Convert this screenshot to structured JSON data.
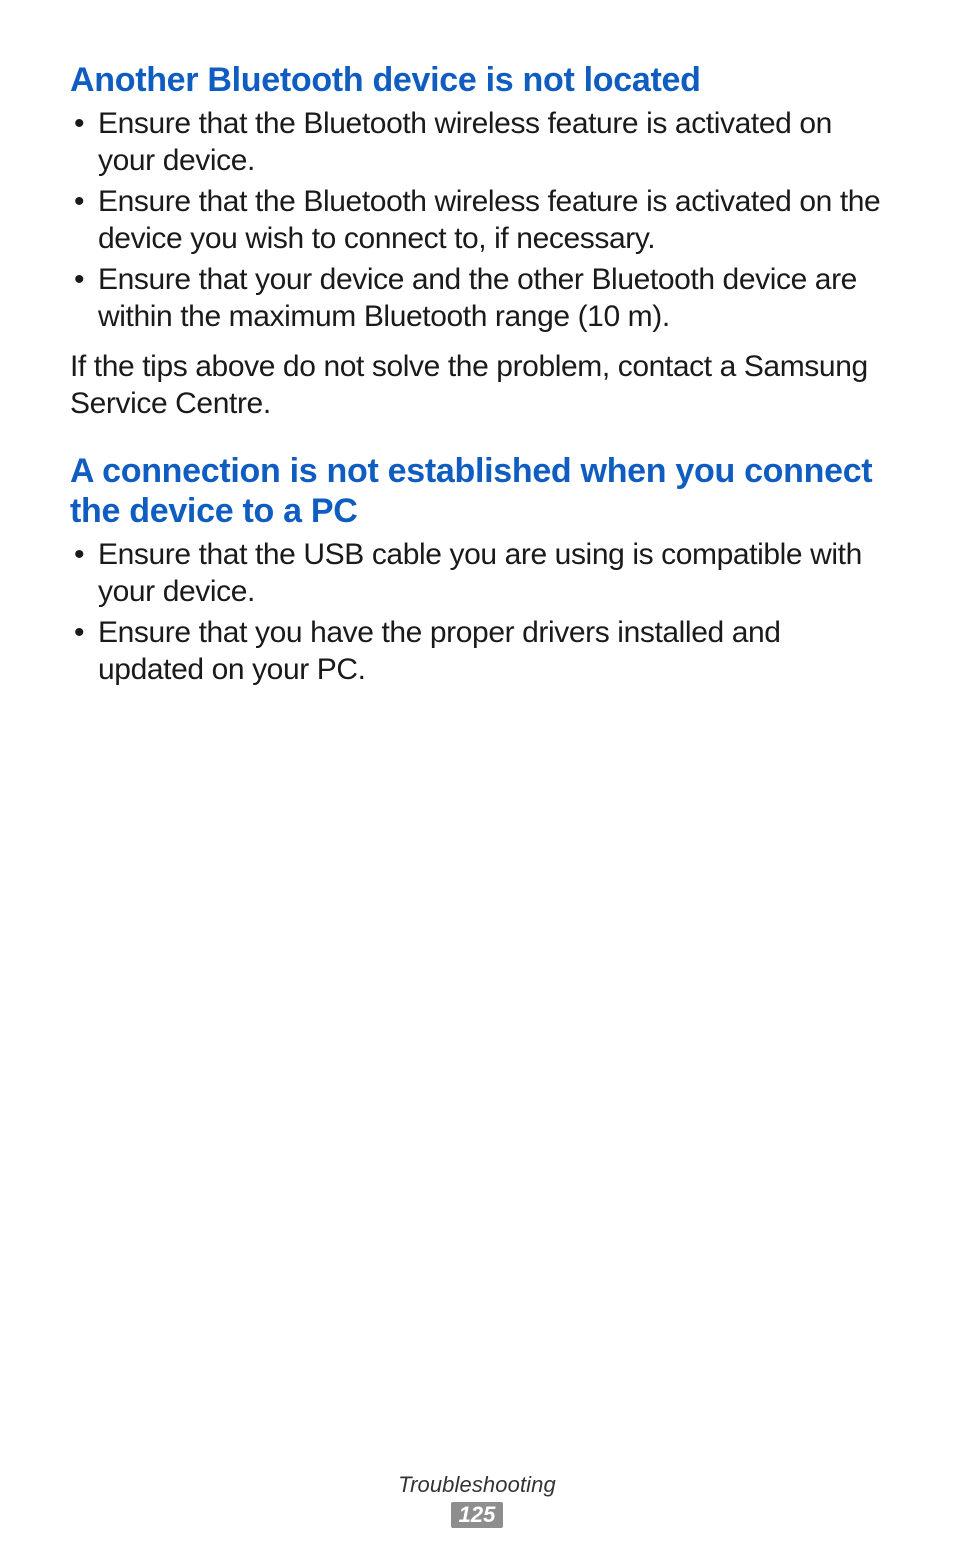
{
  "sections": [
    {
      "heading": "Another Bluetooth device is not located",
      "bullets": [
        "Ensure that the Bluetooth wireless feature is activated on your device.",
        "Ensure that the Bluetooth wireless feature is activated on the device you wish to connect to, if necessary.",
        "Ensure that your device and the other Bluetooth device are within the maximum Bluetooth range (10 m)."
      ],
      "paragraph": "If the tips above do not solve the problem, contact a Samsung Service Centre."
    },
    {
      "heading": "A connection is not established when you connect the device to a PC",
      "bullets": [
        "Ensure that the USB cable you are using is compatible with your device.",
        "Ensure that you have the proper drivers installed and updated on your PC."
      ]
    }
  ],
  "footer": {
    "section_name": "Troubleshooting",
    "page_number": "125"
  }
}
